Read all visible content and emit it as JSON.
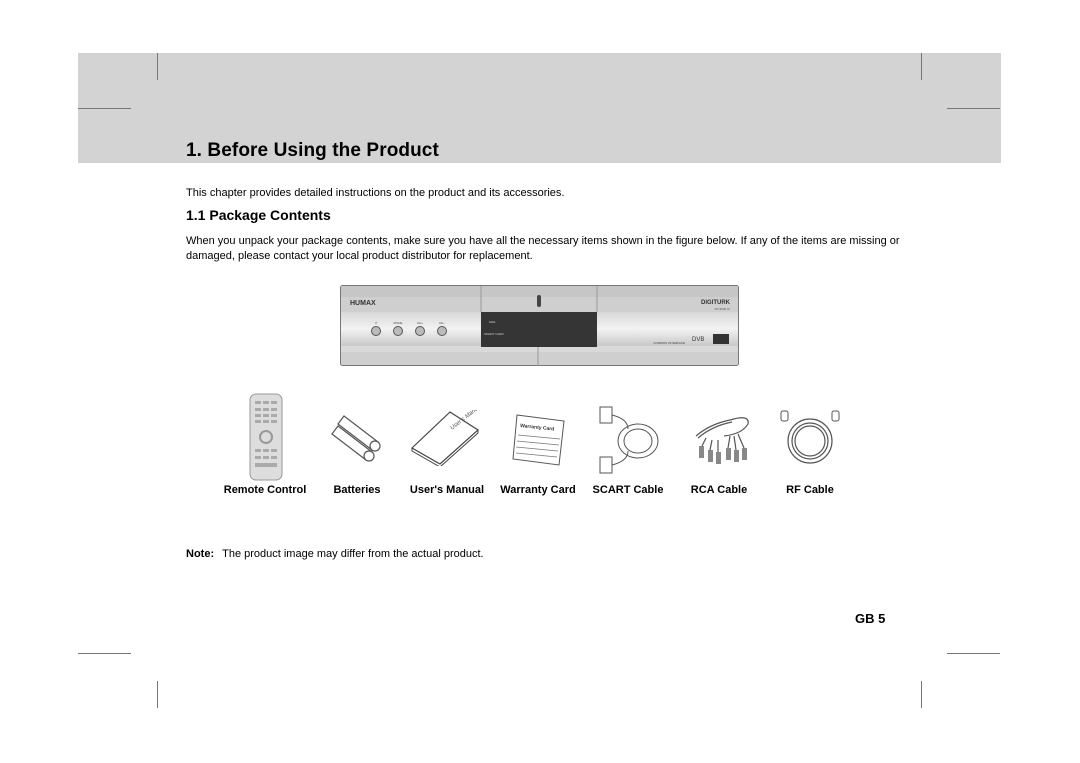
{
  "header": {
    "chapter_title": "1. Before Using the Product"
  },
  "intro_text": "This chapter provides detailed instructions on the product and its accessories.",
  "section": {
    "title": "1.1 Package Contents",
    "paragraph": "When you unpack your package contents, make sure you have all the necessary items shown in the figure below. If any of the items are missing or damaged, please contact your local product distributor for replacement."
  },
  "device": {
    "brand": "HUMAX",
    "operator_logo": "DIGITURK",
    "model": "DT-9500 CI",
    "buttons": [
      "⏻",
      "MODE",
      "CH+",
      "CH−"
    ],
    "display_labels": [
      "MAIL",
      "SMART CARD"
    ],
    "footer_text": "COMMON INTERFACE",
    "dvb_logo": "DVB"
  },
  "accessories": [
    {
      "label": "Remote Control",
      "icon": "remote-control-icon"
    },
    {
      "label": "Batteries",
      "icon": "batteries-icon"
    },
    {
      "label": "User's Manual",
      "icon": "users-manual-icon",
      "cover_text": "User's Manual"
    },
    {
      "label": "Warranty Card",
      "icon": "warranty-card-icon",
      "card_text": "Warranty Card"
    },
    {
      "label": "SCART Cable",
      "icon": "scart-cable-icon"
    },
    {
      "label": "RCA Cable",
      "icon": "rca-cable-icon"
    },
    {
      "label": "RF Cable",
      "icon": "rf-cable-icon"
    }
  ],
  "note": {
    "label": "Note:",
    "text": "The product image may differ from the actual product."
  },
  "page_number": "GB 5"
}
